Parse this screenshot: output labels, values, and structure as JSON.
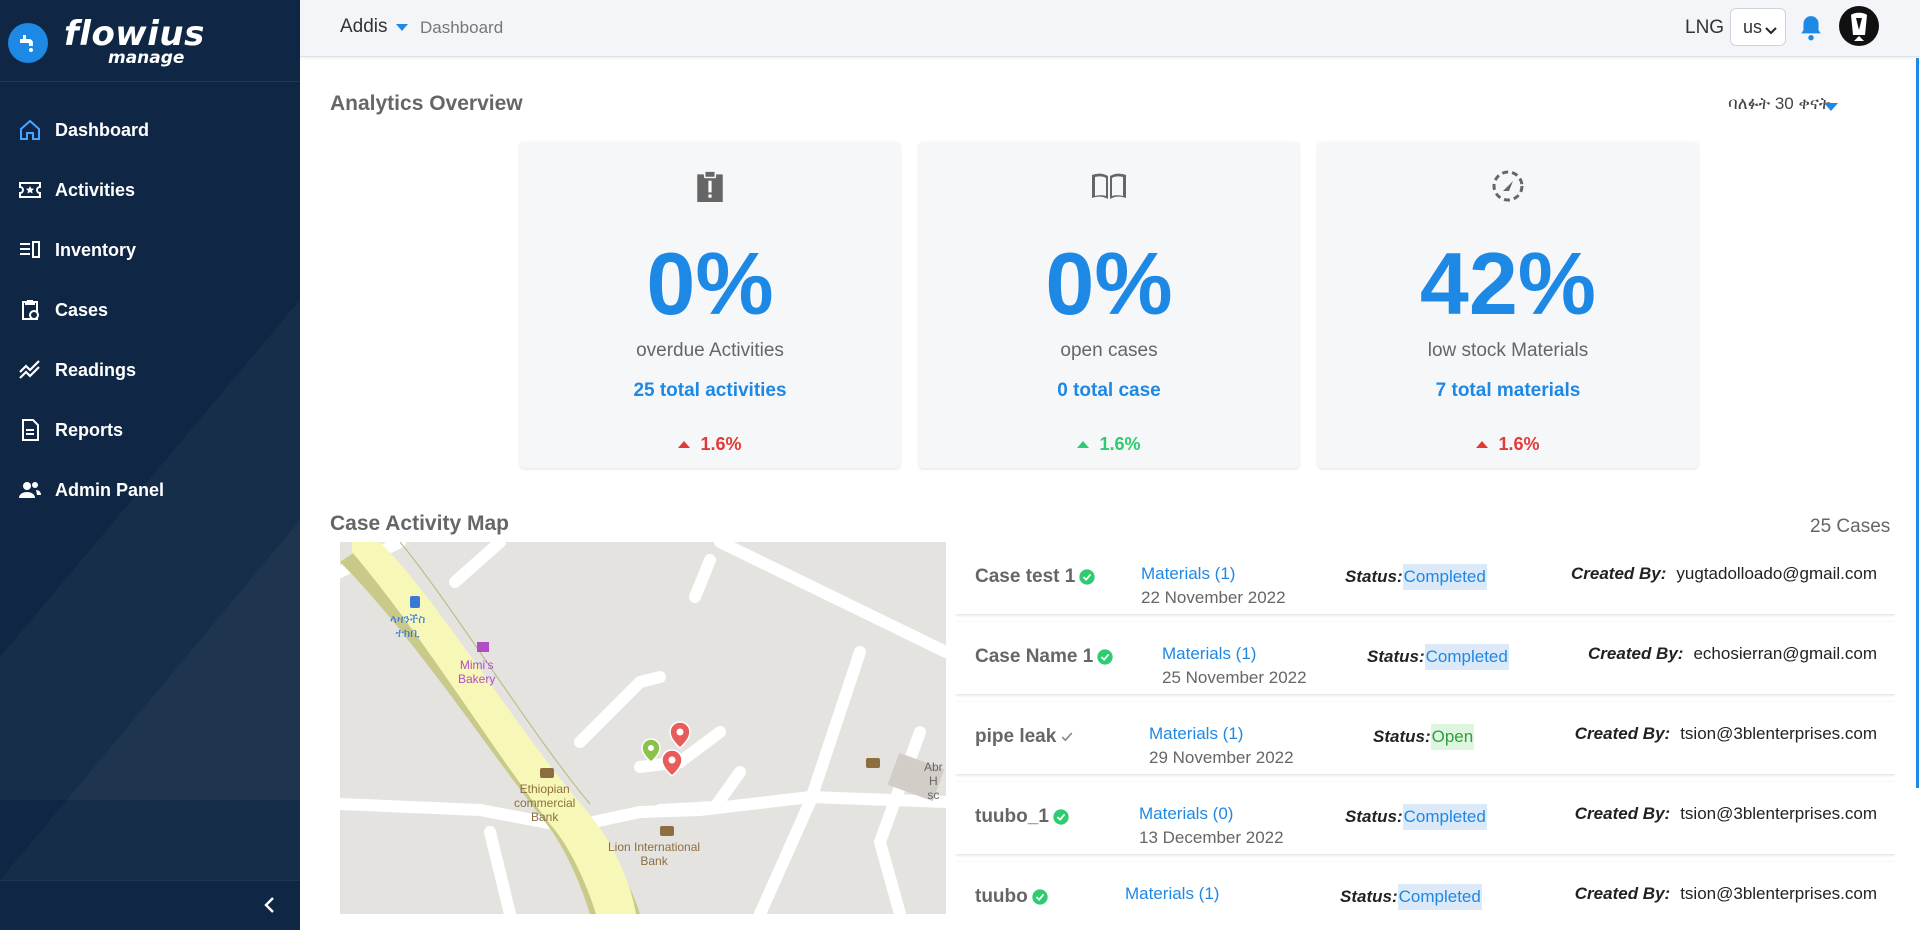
{
  "brand": {
    "name": "flowius",
    "sub": "manage"
  },
  "sidebar": {
    "items": [
      {
        "label": "Dashboard",
        "icon": "home-icon"
      },
      {
        "label": "Activities",
        "icon": "ticket-icon"
      },
      {
        "label": "Inventory",
        "icon": "inventory-icon"
      },
      {
        "label": "Cases",
        "icon": "clipboard-clock-icon"
      },
      {
        "label": "Readings",
        "icon": "trend-icon"
      },
      {
        "label": "Reports",
        "icon": "document-icon"
      },
      {
        "label": "Admin Panel",
        "icon": "users-icon"
      }
    ]
  },
  "topbar": {
    "org": "Addis",
    "breadcrumb": "Dashboard",
    "lng_label": "LNG",
    "lang_value": "us"
  },
  "analytics": {
    "title": "Analytics Overview",
    "period": "ባለፉት 30 ቀናት",
    "cards": [
      {
        "percent": "0%",
        "desc": "overdue Activities",
        "total": "25 total activities",
        "delta": "1.6%",
        "trend": "up-bad",
        "icon": "clipboard-alert-icon"
      },
      {
        "percent": "0%",
        "desc": "open cases",
        "total": "0 total case",
        "delta": "1.6%",
        "trend": "up-good",
        "icon": "book-open-icon"
      },
      {
        "percent": "42%",
        "desc": "low stock Materials",
        "total": "7 total materials",
        "delta": "1.6%",
        "trend": "up-bad",
        "icon": "gauge-icon"
      }
    ]
  },
  "case_map": {
    "title": "Case Activity Map",
    "count": "25 Cases",
    "map_labels": {
      "bakery": "Mimi's\nBakery",
      "bank1": "Ethiopian\ncommercial\nBank",
      "bank2": "Lion International\nBank",
      "bus": "ላዛንችስ\nተክቢ",
      "partial": "Abr\nH\nsc"
    }
  },
  "cases": [
    {
      "name": "Case test 1",
      "verified": true,
      "materials": "Materials (1)",
      "date": "22 November 2022",
      "status_label": "Status:",
      "status": "Completed",
      "created_label": "Created By:",
      "created_by": "yugtadolloado@gmail.com"
    },
    {
      "name": "Case Name 1",
      "verified": true,
      "materials": "Materials (1)",
      "date": "25 November 2022",
      "status_label": "Status:",
      "status": "Completed",
      "created_label": "Created By:",
      "created_by": "echosierran@gmail.com"
    },
    {
      "name": "pipe leak",
      "verified": false,
      "materials": "Materials (1)",
      "date": "29 November 2022",
      "status_label": "Status:",
      "status": "Open",
      "created_label": "Created By:",
      "created_by": "tsion@3blenterprises.com"
    },
    {
      "name": "tuubo_1",
      "verified": true,
      "materials": "Materials (0)",
      "date": "13 December 2022",
      "status_label": "Status:",
      "status": "Completed",
      "created_label": "Created By:",
      "created_by": "tsion@3blenterprises.com"
    },
    {
      "name": "tuubo",
      "verified": true,
      "materials": "Materials (1)",
      "date": "",
      "status_label": "Status:",
      "status": "Completed",
      "created_label": "Created By:",
      "created_by": "tsion@3blenterprises.com"
    }
  ],
  "colors": {
    "sidebar": "#0f2744",
    "accent": "#1e88e5",
    "bad": "#e53935",
    "good": "#2ecc71"
  }
}
